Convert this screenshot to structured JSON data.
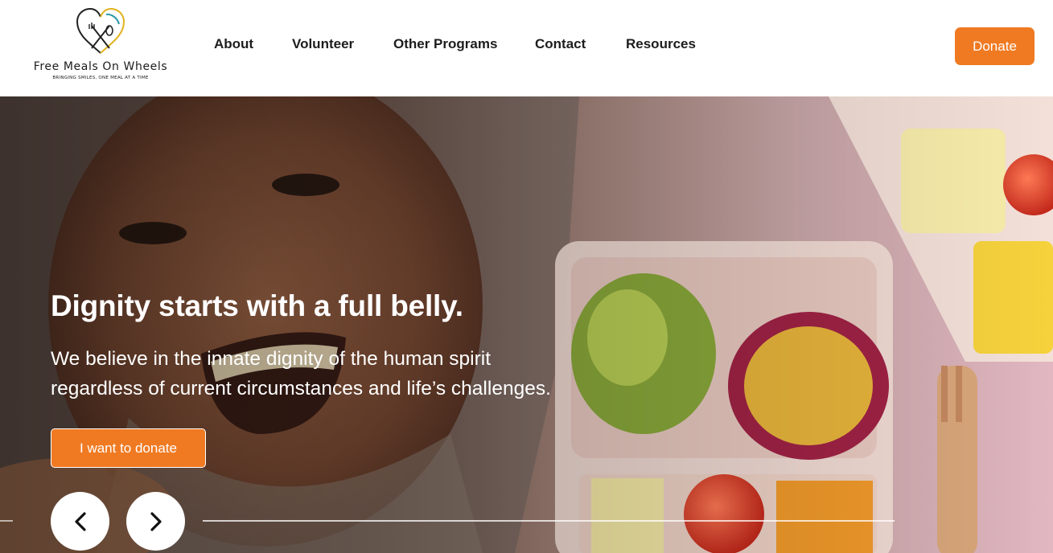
{
  "brand": {
    "name": "Free Meals On Wheels",
    "tagline": "BRINGING SMILES, ONE MEAL AT A TIME",
    "logo_icon": "heart-fork-spoon-icon",
    "accent_color": "#ef7a22"
  },
  "nav": {
    "items": [
      {
        "label": "About"
      },
      {
        "label": "Volunteer"
      },
      {
        "label": "Other Programs"
      },
      {
        "label": "Contact"
      },
      {
        "label": "Resources"
      }
    ]
  },
  "header": {
    "donate_label": "Donate"
  },
  "hero": {
    "title": "Dignity starts with a full belly.",
    "subtitle_line1": "We believe in the innate dignity of the human spirit",
    "subtitle_line2": "regardless of current circumstances and life’s challenges.",
    "cta_label": "I want to donate",
    "prev_icon": "chevron-left-icon",
    "next_icon": "chevron-right-icon"
  }
}
